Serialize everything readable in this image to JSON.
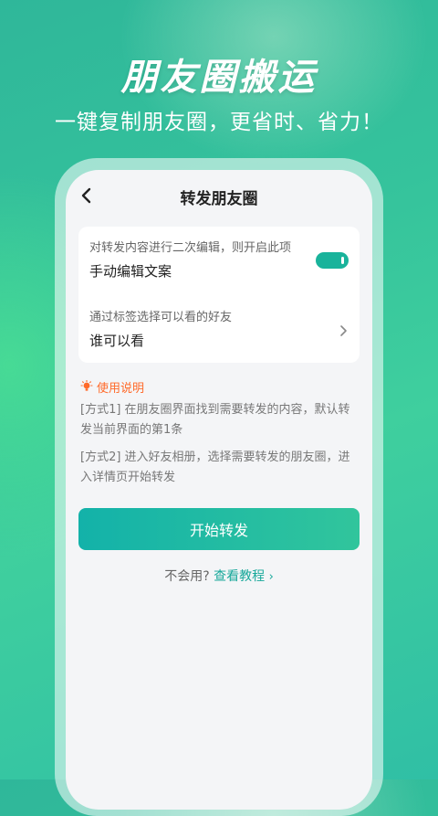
{
  "promo": {
    "title": "朋友圈搬运",
    "subtitle": "一键复制朋友圈，更省时、省力！"
  },
  "header": {
    "title": "转发朋友圈",
    "back_icon": "chevron-left-icon"
  },
  "settings": {
    "edit_desc": "对转发内容进行二次编辑，则开启此项",
    "edit_label": "手动编辑文案",
    "edit_enabled": true,
    "visibility_desc": "通过标签选择可以看的好友",
    "visibility_label": "谁可以看"
  },
  "instructions": {
    "header": "使用说明",
    "method1": "[方式1] 在朋友圈界面找到需要转发的内容，默认转发当前界面的第1条",
    "method2": "[方式2] 进入好友相册，选择需要转发的朋友圈，进入详情页开始转发"
  },
  "actions": {
    "start_label": "开始转发",
    "help_prefix": "不会用?",
    "tutorial_link": "查看教程",
    "tutorial_chevron": "›"
  },
  "colors": {
    "accent": "#19b39b",
    "warning": "#ff6a2a",
    "background": "#3fcf9e"
  }
}
